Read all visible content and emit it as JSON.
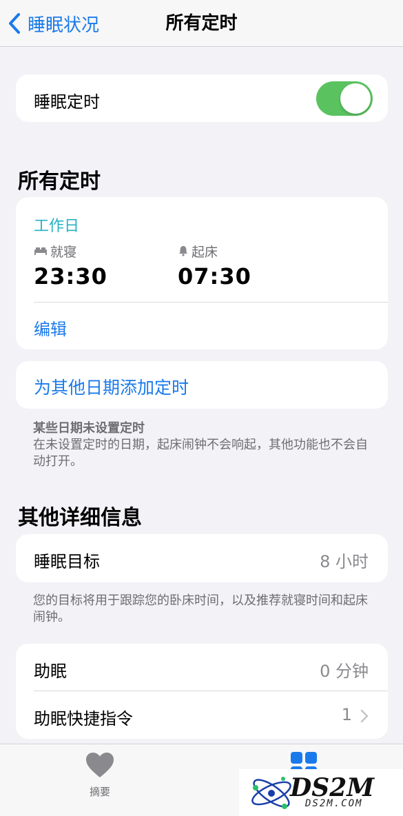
{
  "nav": {
    "back_label": "睡眠状况",
    "title": "所有定时"
  },
  "sleep_schedule_toggle": {
    "label": "睡眠定时",
    "on": true
  },
  "all_schedules": {
    "title": "所有定时",
    "schedule": {
      "name": "工作日",
      "bedtime_label": "就寝",
      "bedtime": "23:30",
      "wake_label": "起床",
      "wake": "07:30",
      "edit_label": "编辑"
    },
    "add_label": "为其他日期添加定时",
    "note_title": "某些日期未设置定时",
    "note_body": "在未设置定时的日期，起床闹钟不会响起，其他功能也不会自动打开。"
  },
  "details": {
    "title": "其他详细信息",
    "sleep_goal_label": "睡眠目标",
    "sleep_goal_value": "8 小时",
    "goal_note": "您的目标将用于跟踪您的卧床时间，以及推荐就寝时间和起床闹钟。",
    "wind_down_label": "助眠",
    "wind_down_value": "0 分钟",
    "shortcuts_label": "助眠快捷指令",
    "shortcuts_value": "1"
  },
  "tabbar": {
    "summary_label": "摘要"
  },
  "watermark": {
    "logo": "DS2M",
    "url": "DS2M.COM"
  },
  "colors": {
    "accent_blue": "#1a7aeb",
    "toggle_green": "#5ac35f",
    "schedule_teal": "#25b1c2"
  }
}
